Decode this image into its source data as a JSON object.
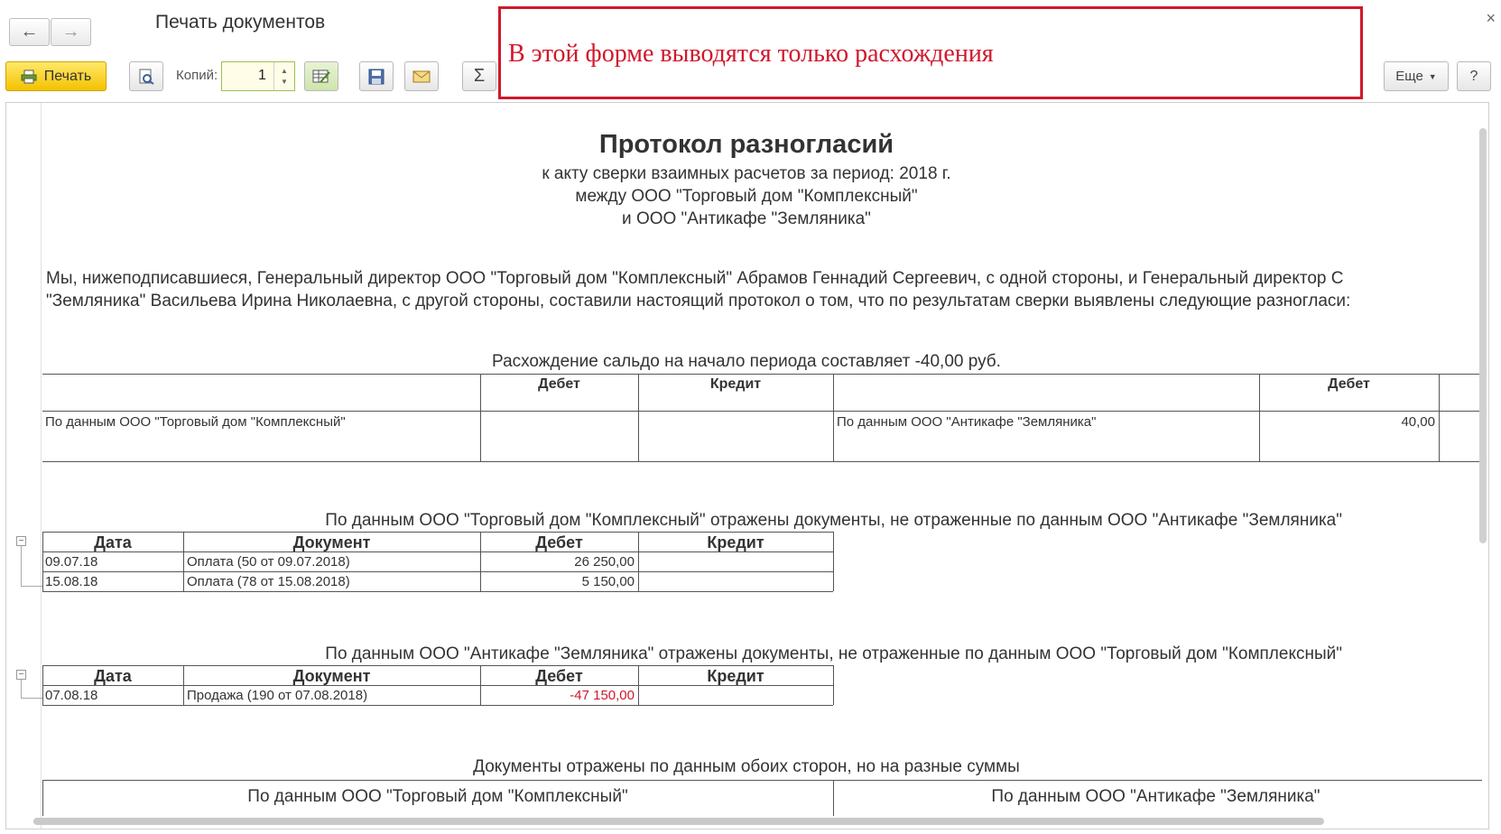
{
  "window": {
    "title": "Печать документов",
    "close_icon": "×",
    "back_icon": "←",
    "forward_icon": "→"
  },
  "toolbar": {
    "print_label": "Печать",
    "copies_label": "Копий:",
    "copies_value": "1",
    "more_label": "Еще",
    "help_label": "?"
  },
  "annotation": {
    "text": "В этой форме выводятся только расхождения"
  },
  "document": {
    "title": "Протокол разногласий",
    "subtitle_1": "к акту сверки взаимных расчетов за период: 2018 г.",
    "subtitle_2": "между ООО \"Торговый дом \"Комплексный\"",
    "subtitle_3": "и ООО \"Антикафе \"Земляника\"",
    "paragraph_1": "Мы, нижеподписавшиеся, Генеральный директор ООО \"Торговый дом \"Комплексный\" Абрамов Геннадий Сергеевич, с одной стороны, и Генеральный директор С",
    "paragraph_2": "\"Земляника\" Васильева Ирина Николаевна, с другой стороны, составили настоящий протокол о том, что по результатам сверки выявлены следующие разногласи:",
    "balance": {
      "caption": "Расхождение сальдо на начало периода составляет -40,00 руб.",
      "debit_header": "Дебет",
      "credit_header": "Кредит",
      "debit_header_right": "Дебет",
      "left_party": "По данным ООО \"Торговый дом \"Комплексный\"",
      "right_party": "По данным ООО \"Антикафе \"Земляника\"",
      "right_debit": "40,00"
    },
    "section_1": {
      "caption": "По данным ООО \"Торговый дом \"Комплексный\" отражены документы, не отраженные по данным ООО \"Антикафе \"Земляника\"",
      "headers": [
        "Дата",
        "Документ",
        "Дебет",
        "Кредит"
      ],
      "rows": [
        {
          "date": "09.07.18",
          "doc": "Оплата (50 от 09.07.2018)",
          "debit": "26 250,00",
          "credit": ""
        },
        {
          "date": "15.08.18",
          "doc": "Оплата (78 от 15.08.2018)",
          "debit": "5 150,00",
          "credit": ""
        }
      ]
    },
    "section_2": {
      "caption": "По данным ООО \"Антикафе \"Земляника\" отражены документы, не отраженные по данным ООО \"Торговый дом \"Комплексный\"",
      "headers": [
        "Дата",
        "Документ",
        "Дебет",
        "Кредит"
      ],
      "rows": [
        {
          "date": "07.08.18",
          "doc": "Продажа (190 от 07.08.2018)",
          "debit": "-47 150,00",
          "credit": ""
        }
      ]
    },
    "section_3": {
      "caption": "Документы отражены по данным обоих сторон, но на разные суммы",
      "left": "По данным ООО \"Торговый дом \"Комплексный\"",
      "right": "По данным ООО \"Антикафе \"Земляника\""
    }
  },
  "colors": {
    "accent_red": "#d0182c",
    "print_button": "#f3c200"
  }
}
